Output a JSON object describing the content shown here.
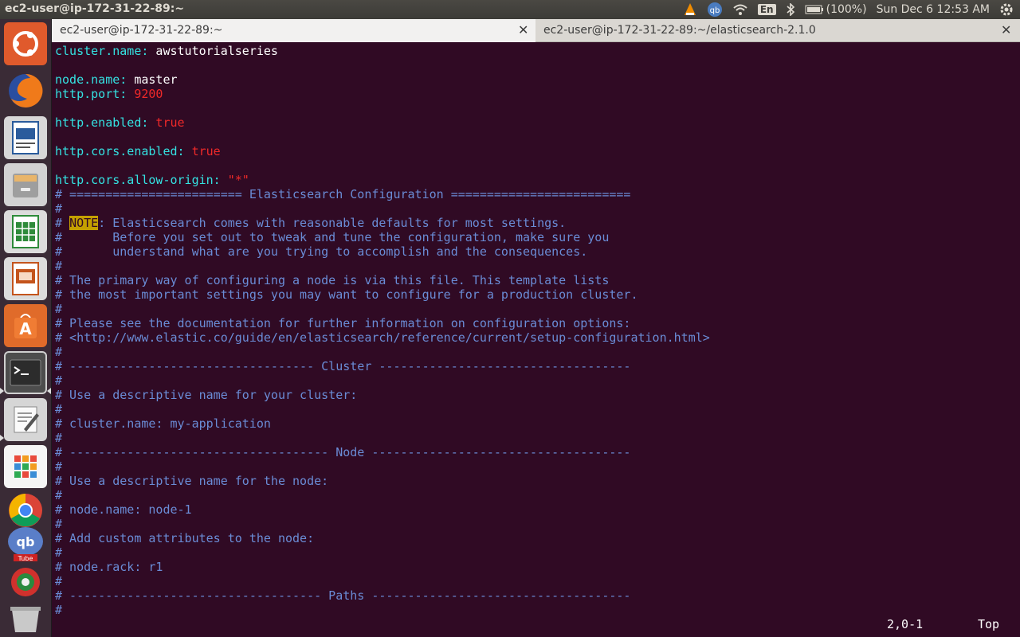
{
  "top_panel": {
    "title": "ec2-user@ip-172-31-22-89:~",
    "lang": "En",
    "battery": "(100%)",
    "clock": "Sun Dec 6 12:53 AM"
  },
  "launcher": {
    "items": [
      "ubuntu-dash-icon",
      "firefox-icon",
      "libreoffice-writer-icon",
      "files-icon",
      "libreoffice-calc-icon",
      "libreoffice-impress-icon",
      "software-center-icon",
      "terminal-icon",
      "text-editor-icon",
      "apps-grid-icon",
      "chrome-icon",
      "qbittorrent-icon",
      "ubuntu-tweak-icon",
      "trash-icon"
    ]
  },
  "tabs": [
    {
      "label": "ec2-user@ip-172-31-22-89:~",
      "active": true
    },
    {
      "label": "ec2-user@ip-172-31-22-89:~/elasticsearch-2.1.0",
      "active": false
    }
  ],
  "close_glyph": "✕",
  "editor": {
    "lines": [
      [
        {
          "t": "cluster.name:",
          "c": "key"
        },
        {
          "t": " awstutorialseries",
          "c": "plain"
        }
      ],
      [],
      [
        {
          "t": "node.name:",
          "c": "key"
        },
        {
          "t": " master",
          "c": "plain"
        }
      ],
      [
        {
          "t": "http.port:",
          "c": "key"
        },
        {
          "t": " 9200",
          "c": "red"
        }
      ],
      [],
      [
        {
          "t": "http.enabled:",
          "c": "key"
        },
        {
          "t": " true",
          "c": "red"
        }
      ],
      [],
      [
        {
          "t": "http.cors.enabled:",
          "c": "key"
        },
        {
          "t": " true",
          "c": "red"
        }
      ],
      [],
      [
        {
          "t": "http.cors.allow-origin:",
          "c": "key"
        },
        {
          "t": " \"*\"",
          "c": "red"
        }
      ],
      [
        {
          "t": "# ======================== Elasticsearch Configuration =========================",
          "c": "comment"
        }
      ],
      [
        {
          "t": "#",
          "c": "comment"
        }
      ],
      [
        {
          "t": "# ",
          "c": "comment"
        },
        {
          "t": "NOTE",
          "c": "note"
        },
        {
          "t": ": Elasticsearch comes with reasonable defaults for most settings.",
          "c": "comment"
        }
      ],
      [
        {
          "t": "#       Before you set out to tweak and tune the configuration, make sure you",
          "c": "comment"
        }
      ],
      [
        {
          "t": "#       understand what are you trying to accomplish and the consequences.",
          "c": "comment"
        }
      ],
      [
        {
          "t": "#",
          "c": "comment"
        }
      ],
      [
        {
          "t": "# The primary way of configuring a node is via this file. This template lists",
          "c": "comment"
        }
      ],
      [
        {
          "t": "# the most important settings you may want to configure for a production cluster.",
          "c": "comment"
        }
      ],
      [
        {
          "t": "#",
          "c": "comment"
        }
      ],
      [
        {
          "t": "# Please see the documentation for further information on configuration options:",
          "c": "comment"
        }
      ],
      [
        {
          "t": "# <http://www.elastic.co/guide/en/elasticsearch/reference/current/setup-configuration.html>",
          "c": "comment"
        }
      ],
      [
        {
          "t": "#",
          "c": "comment"
        }
      ],
      [
        {
          "t": "# ---------------------------------- Cluster -----------------------------------",
          "c": "comment"
        }
      ],
      [
        {
          "t": "#",
          "c": "comment"
        }
      ],
      [
        {
          "t": "# Use a descriptive name for your cluster:",
          "c": "comment"
        }
      ],
      [
        {
          "t": "#",
          "c": "comment"
        }
      ],
      [
        {
          "t": "# cluster.name: my-application",
          "c": "comment"
        }
      ],
      [
        {
          "t": "#",
          "c": "comment"
        }
      ],
      [
        {
          "t": "# ------------------------------------ Node ------------------------------------",
          "c": "comment"
        }
      ],
      [
        {
          "t": "#",
          "c": "comment"
        }
      ],
      [
        {
          "t": "# Use a descriptive name for the node:",
          "c": "comment"
        }
      ],
      [
        {
          "t": "#",
          "c": "comment"
        }
      ],
      [
        {
          "t": "# node.name: node-1",
          "c": "comment"
        }
      ],
      [
        {
          "t": "#",
          "c": "comment"
        }
      ],
      [
        {
          "t": "# Add custom attributes to the node:",
          "c": "comment"
        }
      ],
      [
        {
          "t": "#",
          "c": "comment"
        }
      ],
      [
        {
          "t": "# node.rack: r1",
          "c": "comment"
        }
      ],
      [
        {
          "t": "#",
          "c": "comment"
        }
      ],
      [
        {
          "t": "# ----------------------------------- Paths ------------------------------------",
          "c": "comment"
        }
      ],
      [
        {
          "t": "#",
          "c": "comment"
        }
      ]
    ],
    "cursor_pos": "2,0-1",
    "scroll_pos": "Top"
  }
}
